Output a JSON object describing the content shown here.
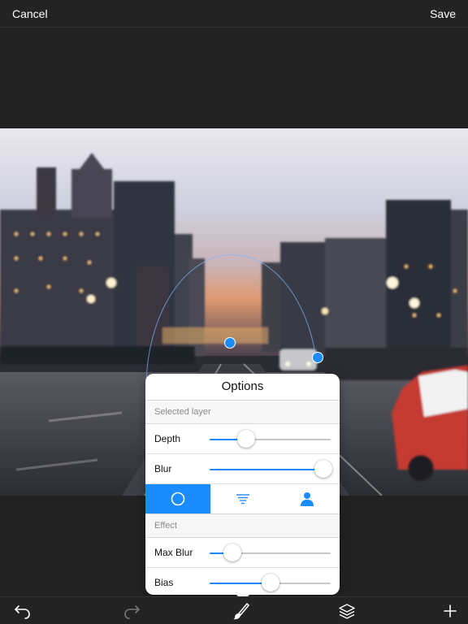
{
  "topbar": {
    "cancel_label": "Cancel",
    "save_label": "Save"
  },
  "options": {
    "title": "Options",
    "selected_layer_header": "Selected layer",
    "depth": {
      "label": "Depth",
      "value": 0.3
    },
    "blur": {
      "label": "Blur",
      "value": 0.94
    },
    "shape_modes": [
      {
        "icon": "circle-icon",
        "selected": true
      },
      {
        "icon": "lines-icon",
        "selected": false
      },
      {
        "icon": "person-icon",
        "selected": false
      }
    ],
    "effect_header": "Effect",
    "max_blur": {
      "label": "Max Blur",
      "value": 0.19
    },
    "bias": {
      "label": "Bias",
      "value": 0.5
    }
  },
  "toolbar": {
    "icons": [
      "undo-icon",
      "redo-icon",
      "brush-icon",
      "layers-icon",
      "add-icon"
    ]
  },
  "colors": {
    "accent": "#1a8cff",
    "bar_bg": "#232323"
  }
}
